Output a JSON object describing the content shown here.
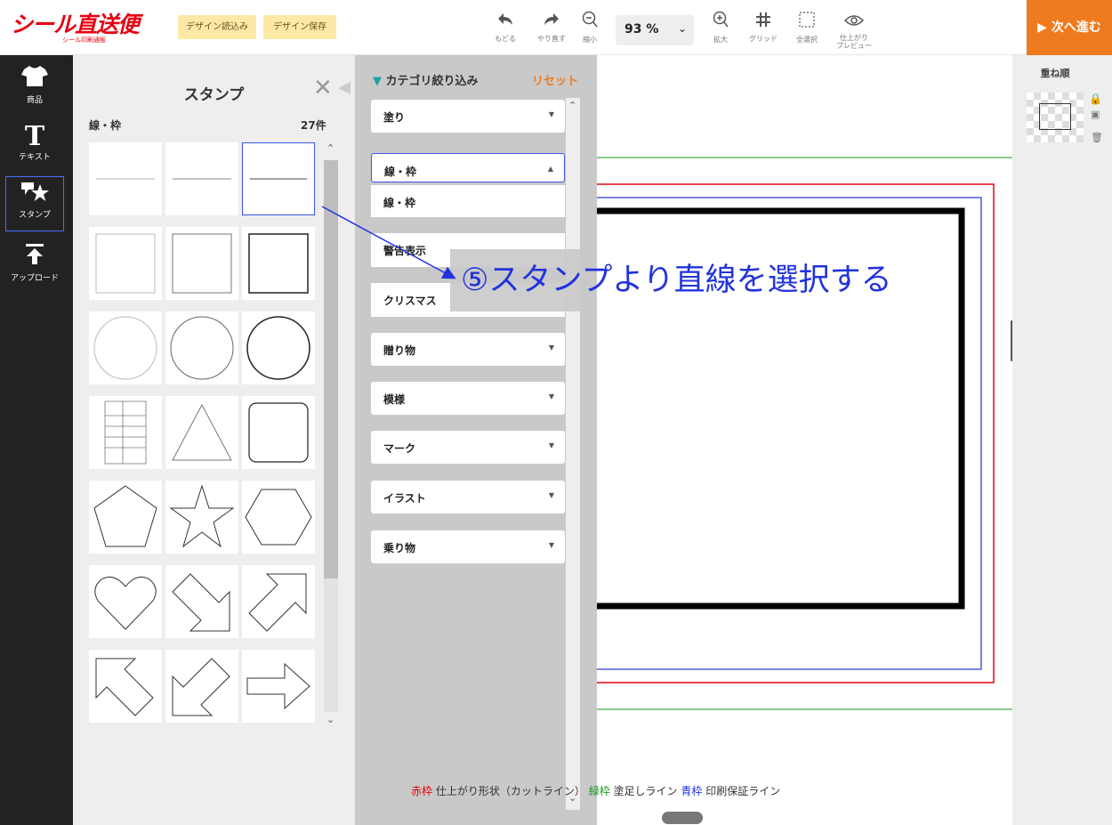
{
  "header": {
    "logo_text": "シール直送便",
    "logo_sub": "シール印刷通販",
    "design_load": "デザイン読込み",
    "design_save": "デザイン保存",
    "tools": {
      "undo": "もどる",
      "redo": "やり直す",
      "zoom_out": "縮小",
      "zoom_value": "93 %",
      "zoom_in": "拡大",
      "grid": "グリッド",
      "select_all": "全選択",
      "preview_line1": "仕上がり",
      "preview_line2": "プレビュー"
    },
    "next_button": "▶ 次へ進む"
  },
  "leftnav": {
    "items": [
      {
        "label": "商品",
        "icon": "tshirt-icon"
      },
      {
        "label": "テキスト",
        "icon": "text-t-icon"
      },
      {
        "label": "スタンプ",
        "icon": "stamp-star-icon"
      },
      {
        "label": "アップロード",
        "icon": "upload-icon"
      }
    ],
    "active": "スタンプ"
  },
  "stamp_panel": {
    "title": "スタンプ",
    "category": "線・枠",
    "count": "27件",
    "selected_index": 2,
    "thumbs": [
      "line-thin",
      "line-medium",
      "line-thick",
      "square-thin",
      "square-medium",
      "square-thick",
      "circle-thin",
      "circle-medium",
      "circle-thick",
      "table",
      "triangle",
      "rounded-square",
      "pentagon",
      "star",
      "hexagon",
      "heart",
      "arrow-down-right",
      "arrow-up-right",
      "arrow-up-left",
      "arrow-down-left",
      "arrow-right"
    ]
  },
  "filter_panel": {
    "title": "カテゴリ絞り込み",
    "reset": "リセット",
    "dropdowns": [
      {
        "label": "塗り",
        "open": false
      },
      {
        "label": "線・枠",
        "open": true
      },
      {
        "label": "線・枠",
        "open": false,
        "caret": ""
      },
      {
        "label": "警告表示",
        "open": false,
        "caret": ""
      },
      {
        "label": "クリスマス",
        "open": false,
        "caret": ""
      },
      {
        "label": "贈り物",
        "open": false
      },
      {
        "label": "模様",
        "open": false
      },
      {
        "label": "マーク",
        "open": false
      },
      {
        "label": "イラスト",
        "open": false
      },
      {
        "label": "乗り物",
        "open": false
      }
    ]
  },
  "canvas": {
    "legend": {
      "red_label": "赤枠",
      "red_text": "仕上がり形状（カットライン）",
      "green_label": "緑枠",
      "green_text": "塗足しライン",
      "blue_label": "青枠",
      "blue_text": "印刷保証ライン"
    },
    "colors": {
      "red": "#e60012",
      "green": "#1a9a1a",
      "blue": "#2233dd"
    }
  },
  "right_panel": {
    "title": "重ね順"
  },
  "annotation": {
    "text": "⑤スタンプより直線を選択する",
    "color": "#2233dd"
  }
}
